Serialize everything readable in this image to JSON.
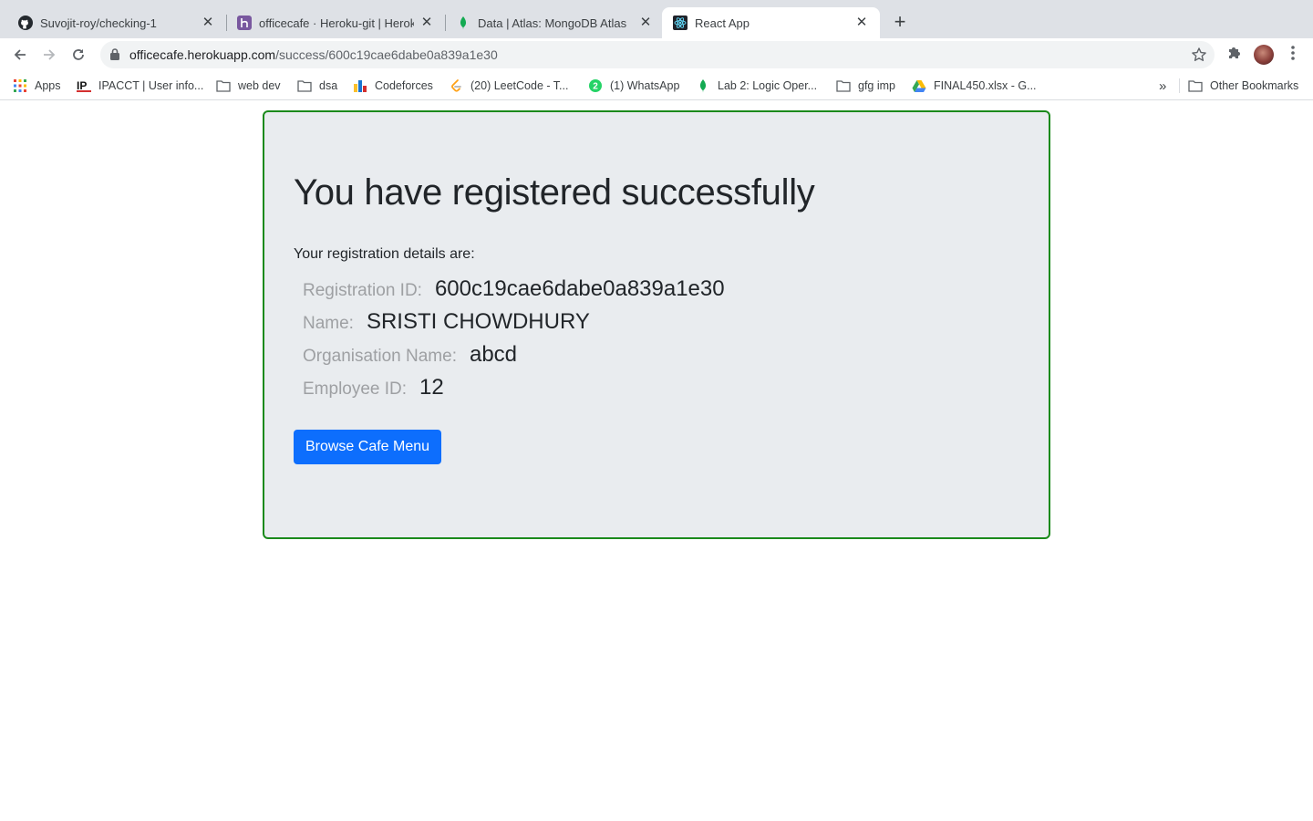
{
  "browser": {
    "tabs": [
      {
        "title": "Suvojit-roy/checking-1",
        "icon": "github-icon",
        "active": false
      },
      {
        "title": "officecafe · Heroku-git | Heroku",
        "icon": "heroku-icon",
        "active": false
      },
      {
        "title": "Data | Atlas: MongoDB Atlas",
        "icon": "mongodb-leaf-icon",
        "active": false
      },
      {
        "title": "React App",
        "icon": "react-icon",
        "active": true
      }
    ],
    "new_tab_label": "+",
    "address": {
      "host": "officecafe.herokuapp.com",
      "path": "/success/600c19cae6dabe0a839a1e30"
    },
    "bookmarks": [
      {
        "label": "Apps",
        "icon": "apps-grid-icon"
      },
      {
        "label": "IPACCT | User info...",
        "icon": "ipacct-icon"
      },
      {
        "label": "web dev",
        "icon": "folder-icon"
      },
      {
        "label": "dsa",
        "icon": "folder-icon"
      },
      {
        "label": "Codeforces",
        "icon": "codeforces-icon"
      },
      {
        "label": "(20) LeetCode - T...",
        "icon": "leetcode-icon"
      },
      {
        "label": "(1) WhatsApp",
        "icon": "whatsapp-icon"
      },
      {
        "label": "Lab 2: Logic Oper...",
        "icon": "mongodb-leaf-icon"
      },
      {
        "label": "gfg imp",
        "icon": "folder-icon"
      },
      {
        "label": "FINAL450.xlsx - G...",
        "icon": "google-drive-icon"
      }
    ],
    "overflow_label": "»",
    "other_bookmarks_label": "Other Bookmarks",
    "whatsapp_badge": "2"
  },
  "page": {
    "heading": "You have registered successfully",
    "intro": "Your registration details are:",
    "details": [
      {
        "label": "Registration ID:",
        "value": "600c19cae6dabe0a839a1e30"
      },
      {
        "label": "Name:",
        "value": "SRISTI CHOWDHURY"
      },
      {
        "label": "Organisation Name:",
        "value": "abcd"
      },
      {
        "label": "Employee ID:",
        "value": "12"
      }
    ],
    "button_label": "Browse Cafe Menu"
  },
  "colors": {
    "card_border": "#1b8a1b",
    "card_background": "#e9ecef",
    "primary_button": "#0d6efd"
  }
}
